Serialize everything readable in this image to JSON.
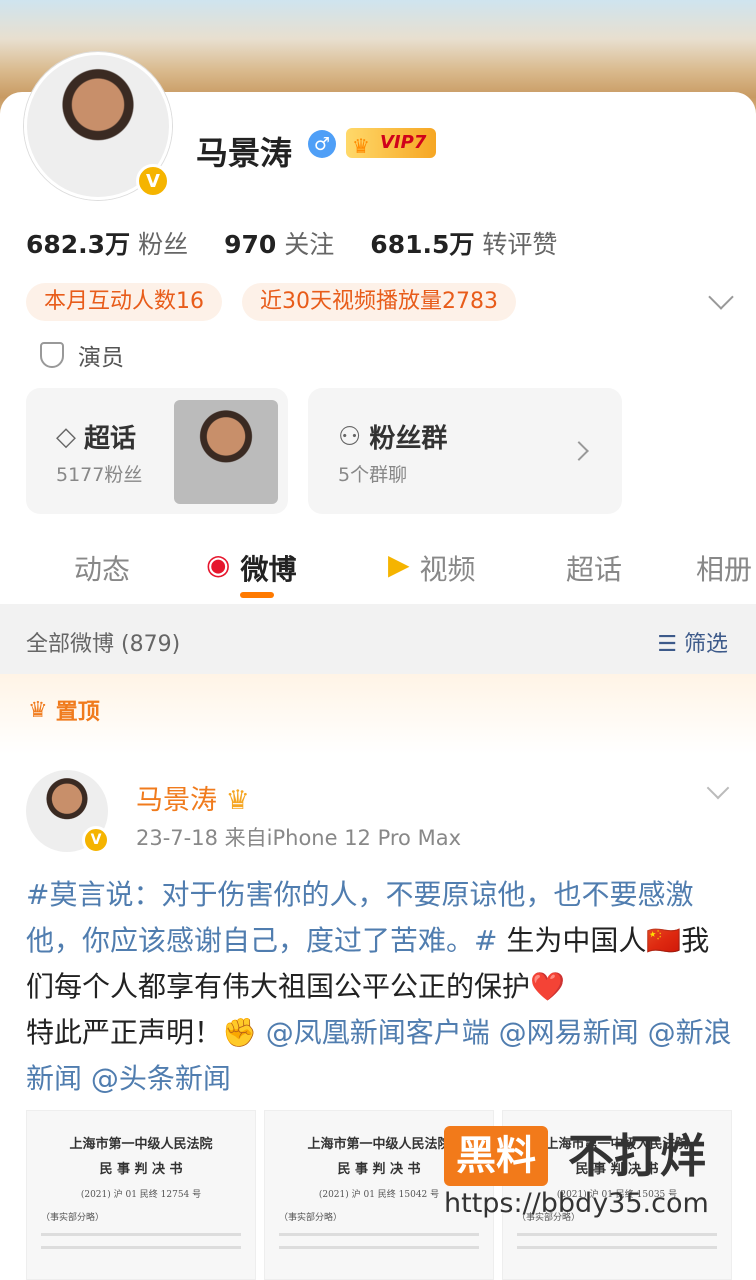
{
  "profile": {
    "name": "马景涛",
    "gender_icon": "male-icon",
    "vip_label": "VIP7",
    "verified_badge": "V",
    "stats": [
      {
        "value": "682.3万",
        "label": "粉丝"
      },
      {
        "value": "970",
        "label": "关注"
      },
      {
        "value": "681.5万",
        "label": "转评赞"
      }
    ],
    "chips": [
      "本月互动人数16",
      "近30天视频播放量2783"
    ],
    "role": "演员",
    "supertopic": {
      "title": "超话",
      "sub": "5177粉丝"
    },
    "fangroup": {
      "title": "粉丝群",
      "sub": "5个群聊"
    }
  },
  "tabs": [
    {
      "label": "动态"
    },
    {
      "label": "微博"
    },
    {
      "label": "视频"
    },
    {
      "label": "超话"
    },
    {
      "label": "相册"
    }
  ],
  "filter": {
    "all_label": "全部微博 (879)",
    "filter_label": "筛选"
  },
  "pinned_label": "置顶",
  "post": {
    "author": "马景涛",
    "meta": "23-7-18  来自iPhone 12 Pro Max",
    "topic": "#莫言说：对于伤害你的人，不要原谅他，也不要感激他，你应该感谢自己，度过了苦难。#",
    "body1": "  生为中国人🇨🇳我们每个人都享有伟大祖国公平公正的保护",
    "heart": "❤️",
    "body2": "特此严正声明！✊",
    "mentions": "@凤凰新闻客户端 @网易新闻 @新浪新闻 @头条新闻"
  },
  "documents": [
    {
      "h1": "上海市第一中级人民法院",
      "h2": "民 事 判 决 书",
      "no": "(2021) 沪 01 民终 12754 号",
      "sec": "（事实部分略）"
    },
    {
      "h1": "上海市第一中级人民法院",
      "h2": "民 事 判 决 书",
      "no": "(2021) 沪 01 民终 15042 号",
      "sec": "（事实部分略）"
    },
    {
      "h1": "上海市第一中级人民法院",
      "h2": "民 事 判 决 书",
      "no": "(2021) 沪 01 民终 15035 号",
      "sec": "（事实部分略）"
    }
  ],
  "watermark": {
    "part1": "黑料",
    "part2": "不打烊",
    "url": "https://bbdy35.com"
  }
}
